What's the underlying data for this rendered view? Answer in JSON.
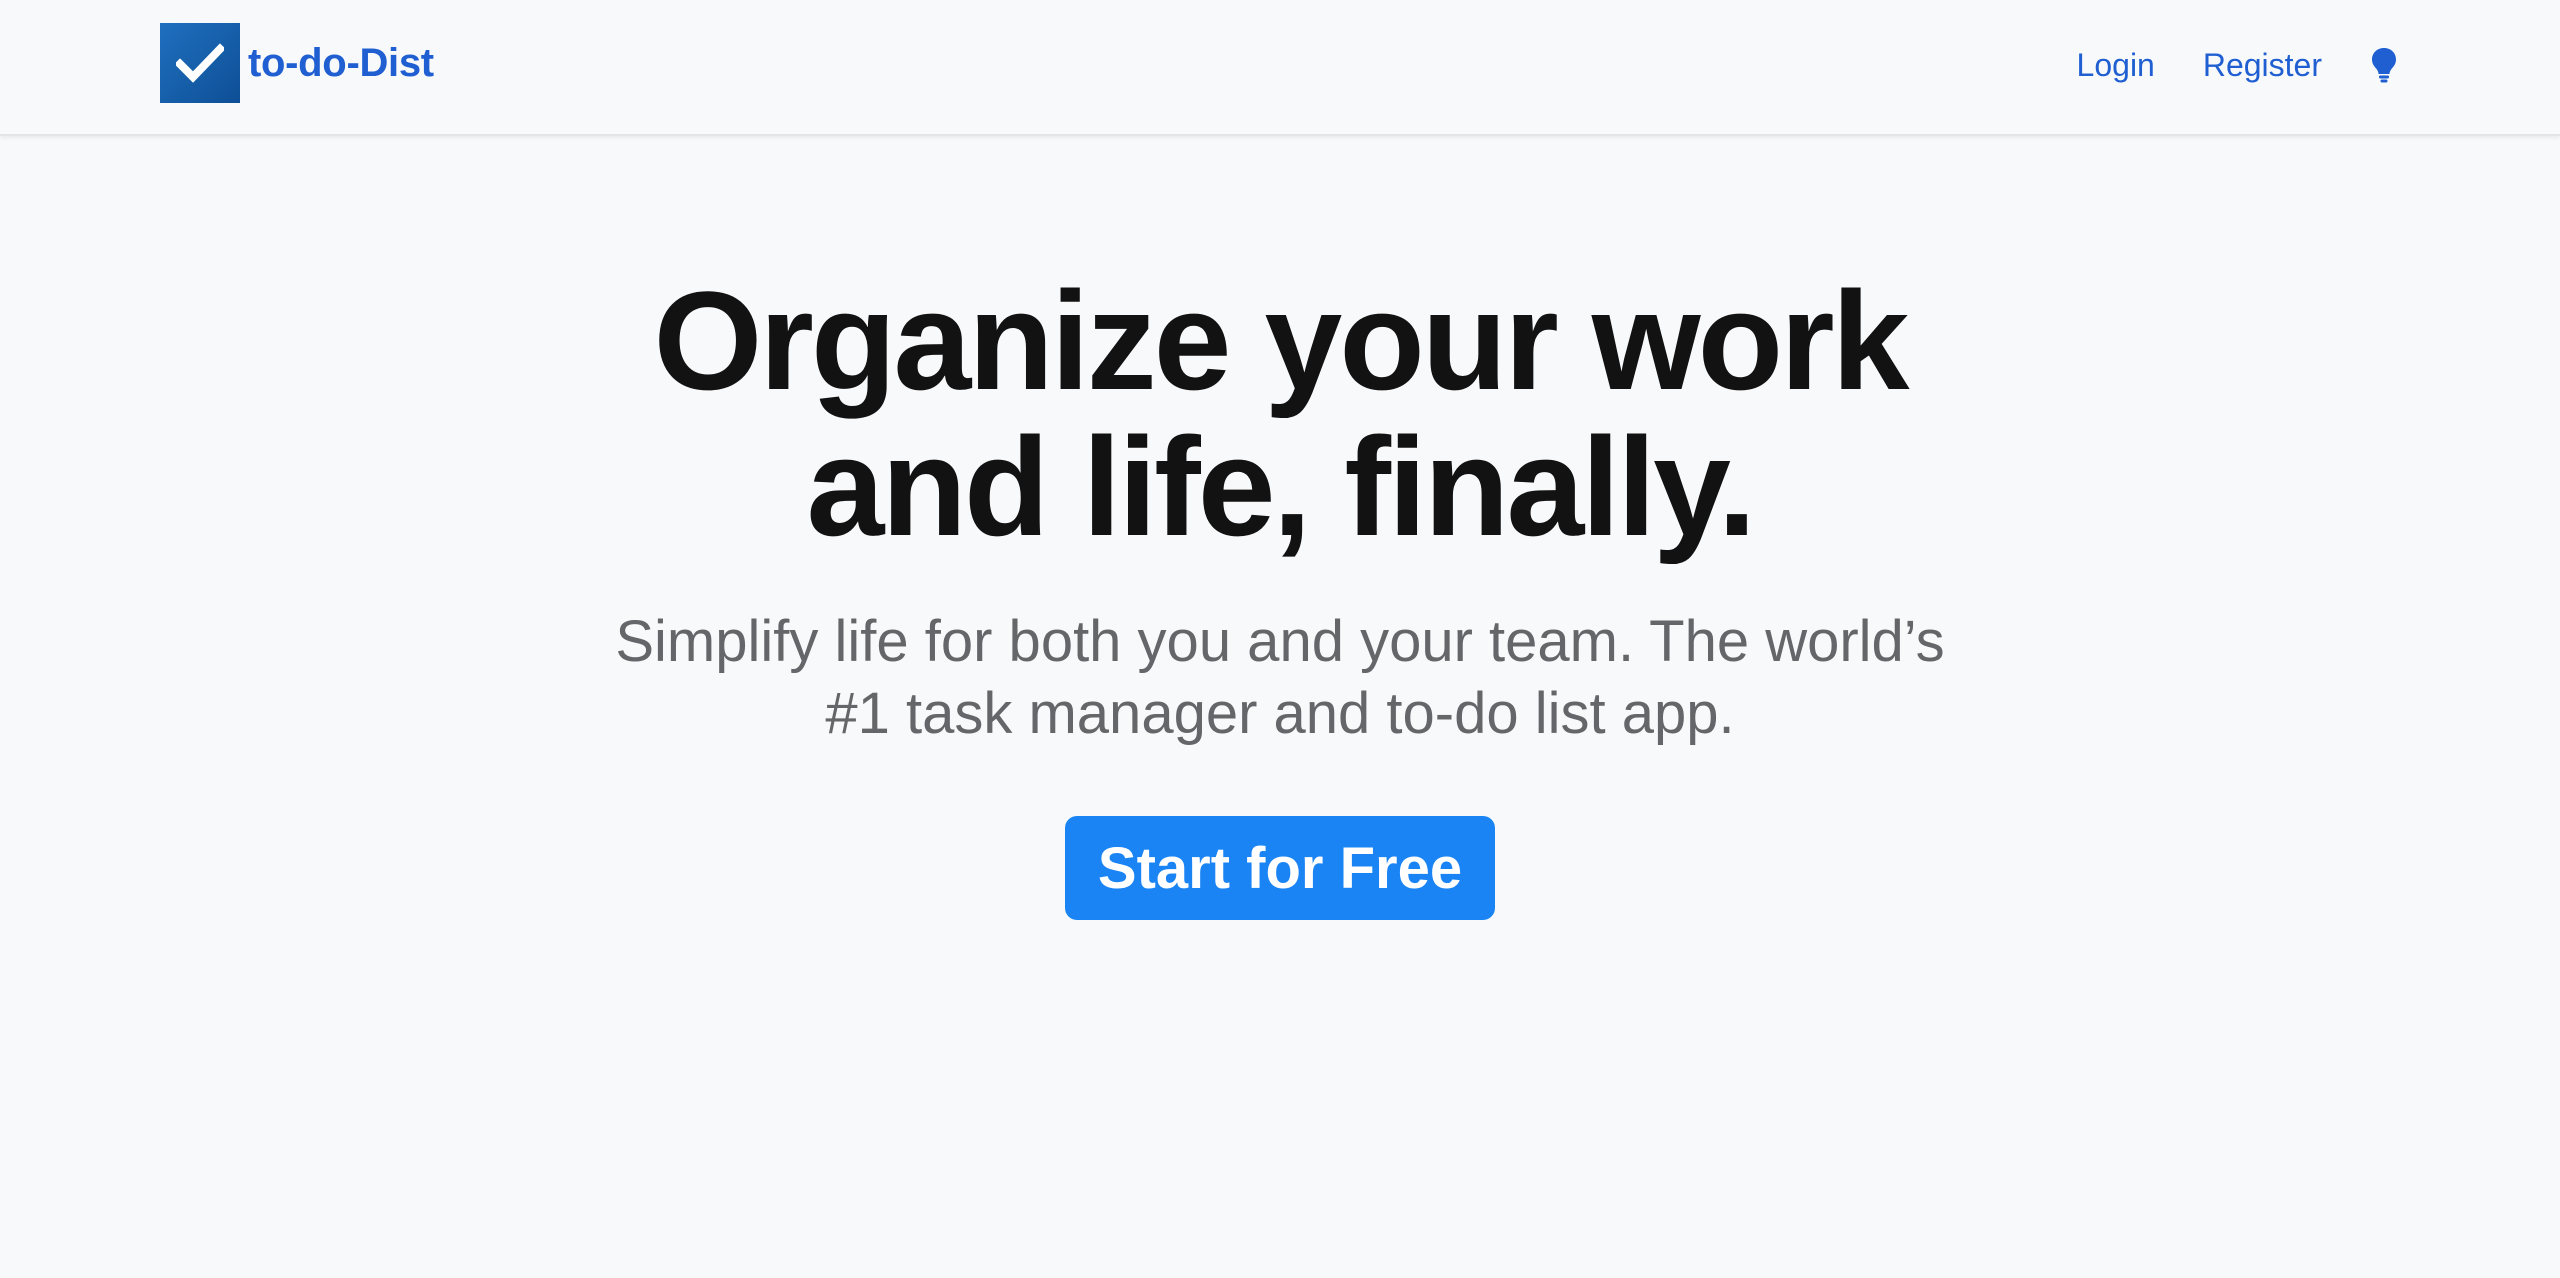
{
  "navbar": {
    "brand_name": "to-do-Dist",
    "brand_icon": "checkmark-icon",
    "links": [
      {
        "label": "Login"
      },
      {
        "label": "Register"
      }
    ],
    "theme_icon": "lightbulb-icon"
  },
  "hero": {
    "title_line1": "Organize your work",
    "title_line2": "and life, finally.",
    "subtitle_line1": "Simplify life for both you and your team. The world’s",
    "subtitle_line2": "#1 task manager and to-do list app.",
    "cta_label": "Start for Free"
  },
  "colors": {
    "background": "#f8f9fb",
    "brand_blue": "#1f5fd1",
    "cta_blue": "#1a84f5",
    "title": "#121212",
    "subtitle": "#646669"
  }
}
